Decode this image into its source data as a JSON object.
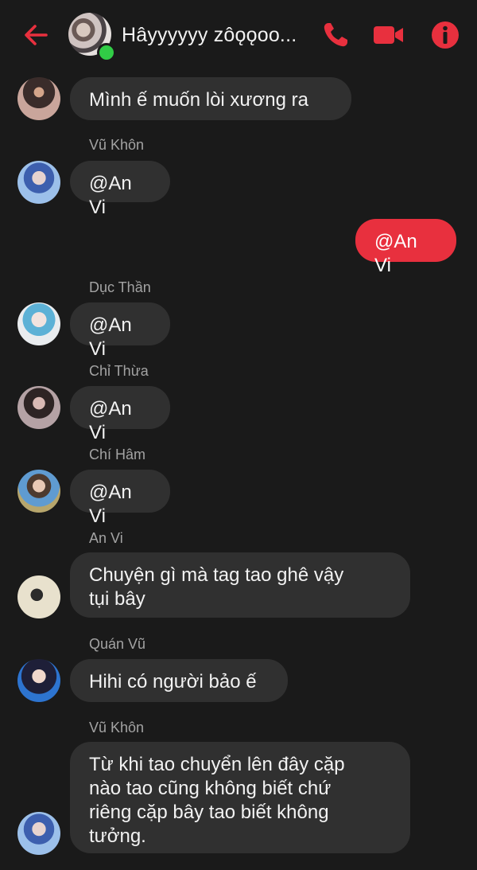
{
  "header": {
    "title": "Hâyyyyyy̯ zôǫǫoo..."
  },
  "colors": {
    "accent": "#e8303e",
    "online": "#31cc46",
    "background": "#1a1a1a",
    "bubble_in": "#303030"
  },
  "messages": [
    {
      "sender": "",
      "text": "Mình ế muốn lòi xương ra"
    },
    {
      "sender": "Vũ Khôn",
      "text": "@An Vi"
    },
    {
      "sender": "",
      "text": "@An Vi",
      "outgoing": true
    },
    {
      "sender": "Dục Thần",
      "text": "@An Vi"
    },
    {
      "sender": "Chỉ Thừa",
      "text": "@An Vi"
    },
    {
      "sender": "Chí Hâm",
      "text": "@An Vi"
    },
    {
      "sender": "An Vi",
      "text_lines": [
        "Chuyện gì mà tag tao ghê vậy",
        "tụi bây"
      ]
    },
    {
      "sender": "Quán Vũ",
      "text": "Hihi có người bảo ế"
    },
    {
      "sender": "Vũ Khôn",
      "text_lines": [
        "Từ khi tao chuyển lên đây cặp",
        "nào tao cũng không biết chứ",
        "riêng cặp bây tao biết không",
        "tưởng."
      ]
    }
  ]
}
